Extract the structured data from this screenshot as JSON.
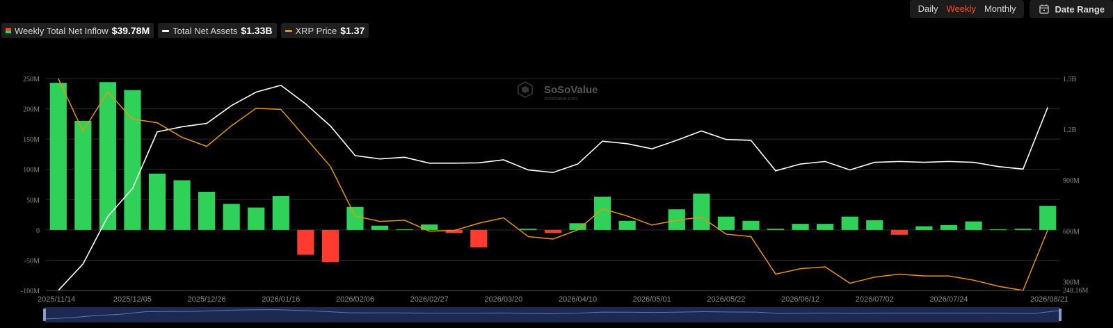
{
  "toolbar": {
    "periods": [
      "Daily",
      "Weekly",
      "Monthly"
    ],
    "active_period": "Weekly",
    "date_range_label": "Date Range"
  },
  "legend": [
    {
      "label": "Weekly Total Net Inflow",
      "value": "$39.78M"
    },
    {
      "label": "Total Net Assets",
      "value": "$1.33B"
    },
    {
      "label": "XRP Price",
      "value": "$1.37"
    }
  ],
  "watermark": {
    "brand": "SoSoValue",
    "url": "sosovalue.com"
  },
  "colors": {
    "inflow_positive": "#30d158",
    "inflow_negative": "#ff3b30",
    "net_assets_line": "#ffffff",
    "price_line": "#e8950b",
    "active_tab": "#ff4f23",
    "navigator_fill": "#1c2a52"
  },
  "chart_data": {
    "type": "bar",
    "title": "",
    "left_axis": {
      "ticks": [
        250,
        200,
        150,
        100,
        50,
        0,
        -50,
        -100
      ],
      "tick_labels": [
        "250M",
        "200M",
        "150M",
        "100M",
        "50M",
        "0",
        "-50M",
        "-100M"
      ],
      "ylim": [
        -100,
        250
      ]
    },
    "right_axis": {
      "ticks": [
        1500,
        1200,
        900,
        600,
        300
      ],
      "tick_labels": [
        "1.5B",
        "1.2B",
        "900M",
        "600M",
        "300M"
      ],
      "ylim": [
        248.16,
        1500
      ],
      "min_label": "248.16M"
    },
    "x_tick_labels": [
      "2025/11/14",
      "2025/12/05",
      "2025/12/26",
      "2026/01/16",
      "2026/02/06",
      "2026/02/27",
      "2026/03/20",
      "2026/04/10",
      "2026/05/01",
      "2026/05/22",
      "2026/06/12",
      "2026/07/02",
      "2026/07/24",
      "2026/08/21"
    ],
    "x_tick_week_index": [
      0,
      3,
      6,
      9,
      12,
      15,
      18,
      21,
      24,
      27,
      30,
      33,
      36,
      40
    ],
    "grid": true,
    "series": [
      {
        "name": "Weekly Total Net Inflow",
        "type": "bar",
        "axis": "left",
        "values": [
          243,
          180,
          244,
          231,
          93,
          82,
          63,
          43,
          37,
          56,
          -41,
          -53,
          38,
          7,
          1,
          9,
          -5,
          -29,
          0,
          2,
          -5,
          11,
          55,
          15,
          0,
          34,
          60,
          22,
          15,
          2,
          10,
          10,
          22,
          16,
          -8,
          6,
          8,
          14,
          1,
          2,
          39.78
        ]
      },
      {
        "name": "Total Net Assets",
        "type": "line",
        "axis": "right",
        "values": [
          248,
          405,
          685,
          850,
          1185,
          1215,
          1235,
          1340,
          1420,
          1460,
          1350,
          1220,
          1045,
          1025,
          1035,
          1000,
          1000,
          1002,
          1020,
          960,
          945,
          995,
          1130,
          1115,
          1085,
          1135,
          1190,
          1140,
          1135,
          955,
          995,
          1010,
          960,
          1005,
          1010,
          1005,
          1010,
          1005,
          980,
          965,
          1330
        ]
      },
      {
        "name": "XRP Price",
        "type": "line",
        "axis": "left",
        "values": [
          250,
          163,
          228,
          183,
          177,
          153,
          138,
          172,
          201,
          199,
          152,
          105,
          23,
          14,
          16,
          -2,
          -1,
          11,
          20,
          -11,
          -15,
          0,
          35,
          23,
          8,
          16,
          21,
          -7,
          -11,
          -73,
          -64,
          -61,
          -88,
          -78,
          -73,
          -76,
          -76,
          -83,
          -93,
          -100,
          0
        ]
      }
    ]
  }
}
